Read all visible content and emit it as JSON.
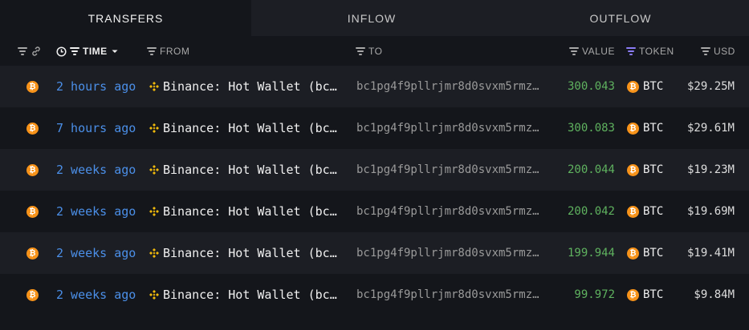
{
  "tabs": [
    {
      "label": "TRANSFERS",
      "active": true
    },
    {
      "label": "INFLOW",
      "active": false
    },
    {
      "label": "OUTFLOW",
      "active": false
    }
  ],
  "columns": {
    "time": "TIME",
    "from": "FROM",
    "to": "TO",
    "value": "VALUE",
    "token": "TOKEN",
    "usd": "USD"
  },
  "rows": [
    {
      "time": "2 hours ago",
      "from": "Binance: Hot Wallet (bc…",
      "to": "bc1pg4f9pllrjmr8d0svxm5rmz…",
      "value": "300.043",
      "token": "BTC",
      "usd": "$29.25M"
    },
    {
      "time": "7 hours ago",
      "from": "Binance: Hot Wallet (bc…",
      "to": "bc1pg4f9pllrjmr8d0svxm5rmz…",
      "value": "300.083",
      "token": "BTC",
      "usd": "$29.61M"
    },
    {
      "time": "2 weeks ago",
      "from": "Binance: Hot Wallet (bc…",
      "to": "bc1pg4f9pllrjmr8d0svxm5rmz…",
      "value": "200.044",
      "token": "BTC",
      "usd": "$19.23M"
    },
    {
      "time": "2 weeks ago",
      "from": "Binance: Hot Wallet (bc…",
      "to": "bc1pg4f9pllrjmr8d0svxm5rmz…",
      "value": "200.042",
      "token": "BTC",
      "usd": "$19.69M"
    },
    {
      "time": "2 weeks ago",
      "from": "Binance: Hot Wallet (bc…",
      "to": "bc1pg4f9pllrjmr8d0svxm5rmz…",
      "value": "199.944",
      "token": "BTC",
      "usd": "$19.41M"
    },
    {
      "time": "2 weeks ago",
      "from": "Binance: Hot Wallet (bc…",
      "to": "bc1pg4f9pllrjmr8d0svxm5rmz…",
      "value": "99.972",
      "token": "BTC",
      "usd": "$9.84M"
    }
  ],
  "icons": {
    "chain": "bitcoin-icon",
    "entity": "binance-icon",
    "token": "bitcoin-icon"
  },
  "colors": {
    "time_link": "#4b8fe8",
    "value": "#5fb25f",
    "btc": "#f7931a",
    "binance": "#f0b90b",
    "token_filter": "#8b7cf6"
  }
}
